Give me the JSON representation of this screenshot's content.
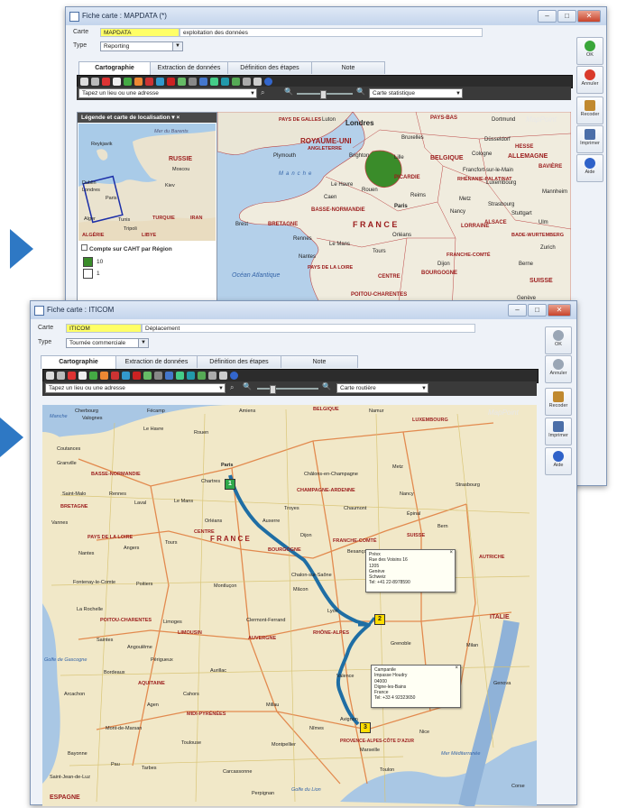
{
  "windows": {
    "back": {
      "title": "Fiche carte : MAPDATA (*)",
      "carte_label": "Carte",
      "carte_code": "MAPDATA",
      "carte_desc": "exploitation des données",
      "type_label": "Type",
      "type_value": "Reporting",
      "tabs": [
        "Cartographie",
        "Extraction de données",
        "Définition des étapes",
        "Note"
      ],
      "search_placeholder": "Tapez un lieu ou une adresse",
      "map_style": "Carte statistique",
      "buttons": [
        {
          "label": "OK",
          "icon": "check-icon",
          "color": "#3aa63a"
        },
        {
          "label": "Annuler",
          "icon": "cancel-icon",
          "color": "#d93a2b"
        },
        {
          "label": "Recoder",
          "icon": "recode-icon",
          "color": "#c0892f"
        },
        {
          "label": "Imprimer",
          "icon": "printer-icon",
          "color": "#4b6ea8"
        },
        {
          "label": "Aide",
          "icon": "help-icon",
          "color": "#2f62c9"
        }
      ],
      "legend": {
        "header": "Légende et carte de localisation ▾ ×",
        "title": "Compte sur CAHT par Région",
        "items": [
          {
            "label": "10",
            "color": "#3a8c2a"
          },
          {
            "label": "1",
            "color": "#ffffff"
          }
        ],
        "mini_map_labels": [
          "Reykjavik",
          "Mer du Barents",
          "RUSSIE",
          "Moscou",
          "Dublin",
          "Londres",
          "Paris",
          "Kiev",
          "Alger",
          "Tunis",
          "Tripoli",
          "TURQUIE",
          "IRAN",
          "ALGÉRIE",
          "LIBYE"
        ]
      },
      "map_labels": [
        "PAYS DE GALLES",
        "ROYAUME-UNI",
        "ANGLETERRE",
        "Londres",
        "Luton",
        "Plymouth",
        "Brighton",
        "PAYS-BAS",
        "Dortmund",
        "MapPoint",
        "Bruxelles",
        "BELGIQUE",
        "Lille",
        "Düsseldorf",
        "Cologne",
        "HESSE",
        "ALLEMAGNE",
        "Francfort-sur-le-Main",
        "RHÉNANIE-PALATINAT",
        "BAVIÈRE",
        "PICARDIE",
        "Le Havre",
        "Caen",
        "Rouen",
        "Reims",
        "Paris",
        "Metz",
        "Nancy",
        "Strasbourg",
        "Stuttgart",
        "LORRAINE",
        "ALSACE",
        "BADE-WURTEMBERG",
        "BASSE-NORMANDIE",
        "Brest",
        "BRETAGNE",
        "Rennes",
        "Le Mans",
        "Orléans",
        "Tours",
        "Nantes",
        "PAYS DE LA LOIRE",
        "CENTRE",
        "BOURGOGNE",
        "FRANCHE-COMTÉ",
        "Dijon",
        "Berne",
        "Zurich",
        "SUISSE",
        "Genève",
        "POITOU-CHARENTES",
        "Océan Atlantique",
        "Manche",
        "F R A N C E",
        "Ulm",
        "Mannheim",
        "Luxembourg"
      ]
    },
    "front": {
      "title": "Fiche carte : ITICOM",
      "carte_label": "Carte",
      "carte_code": "ITICOM",
      "carte_desc": "Déplacement",
      "type_label": "Type",
      "type_value": "Tournée commerciale",
      "tabs": [
        "Cartographie",
        "Extraction de données",
        "Définition des étapes",
        "Note"
      ],
      "search_placeholder": "Tapez un lieu ou une adresse",
      "map_style": "Carte routière",
      "buttons": [
        {
          "label": "OK",
          "icon": "check-icon",
          "color": "#9aa6b5"
        },
        {
          "label": "Annuler",
          "icon": "cancel-icon",
          "color": "#9aa6b5"
        },
        {
          "label": "Recoder",
          "icon": "recode-icon",
          "color": "#c0892f"
        },
        {
          "label": "Imprimer",
          "icon": "printer-icon",
          "color": "#4b6ea8"
        },
        {
          "label": "Aide",
          "icon": "help-icon",
          "color": "#2f62c9"
        }
      ],
      "callouts": [
        {
          "lines": [
            "Prévx",
            "Rue des Voisins 16",
            "1205",
            "Genève",
            "Schweiz",
            "Tel: +41 22-8978590"
          ]
        },
        {
          "lines": [
            "Campanile",
            "Impasse Houdry",
            "04000",
            "Digne-les-Bains",
            "France",
            "Tel: +33 4 92323650"
          ]
        }
      ],
      "pins": [
        "1",
        "2",
        "3"
      ],
      "map_labels": [
        "Manche",
        "Cherbourg",
        "Valognes",
        "Fécamp",
        "Le Havre",
        "Rouen",
        "Amiens",
        "BELGIQUE",
        "Namur",
        "LUXEMBOURG",
        "MapPoint",
        "Coutances",
        "Granville",
        "BASSE-NORMANDIE",
        "Paris",
        "Châlons-en-Champagne",
        "Metz",
        "Nancy",
        "Strasbourg",
        "Saint-Malo",
        "BRETAGNE",
        "Rennes",
        "Laval",
        "Le Mans",
        "Chartres",
        "Troyes",
        "CHAMPAGNE-ARDENNE",
        "Chaumont",
        "Épinal",
        "Vannes",
        "Nantes",
        "PAYS DE LA LOIRE",
        "Angers",
        "Tours",
        "Orléans",
        "CENTRE",
        "Auxerre",
        "F R A N C E",
        "BOURGOGNE",
        "FRANCHE-COMTÉ",
        "Besançon",
        "SUISSE",
        "Bern",
        "Dijon",
        "Chalon-sur-Saône",
        "Fontenay-le-Comte",
        "Poitiers",
        "Montluçon",
        "Mâcon",
        "AUTRICHE",
        "La Rochelle",
        "POITOU-CHARENTES",
        "Limoges",
        "Clermont-Ferrand",
        "Lyon",
        "Grenoble",
        "ITALIE",
        "Saintes",
        "Angoulême",
        "Périgueux",
        "LIMOUSIN",
        "AUVERGNE",
        "RHÔNE-ALPES",
        "Golfe de Gascogne",
        "Bordeaux",
        "AQUITAINE",
        "Aurillac",
        "Valence",
        "Milan",
        "Arcachon",
        "Agen",
        "Cahors",
        "MIDI-PYRÉNÉES",
        "Millau",
        "Nîmes",
        "Avignon",
        "Genova",
        "Mont-de-Marsan",
        "Toulouse",
        "Montpellier",
        "Marseille",
        "Nice",
        "Bayonne",
        "Pau",
        "Tarbes",
        "Carcassonne",
        "Perpignan",
        "Toulon",
        "PROVENCE-ALPES-CÔTE D'AZUR",
        "ESPAGNE",
        "Golfe du Lion",
        "Mer Méditerranée",
        "Saint-Jean-de-Luz",
        "Corse"
      ]
    }
  }
}
